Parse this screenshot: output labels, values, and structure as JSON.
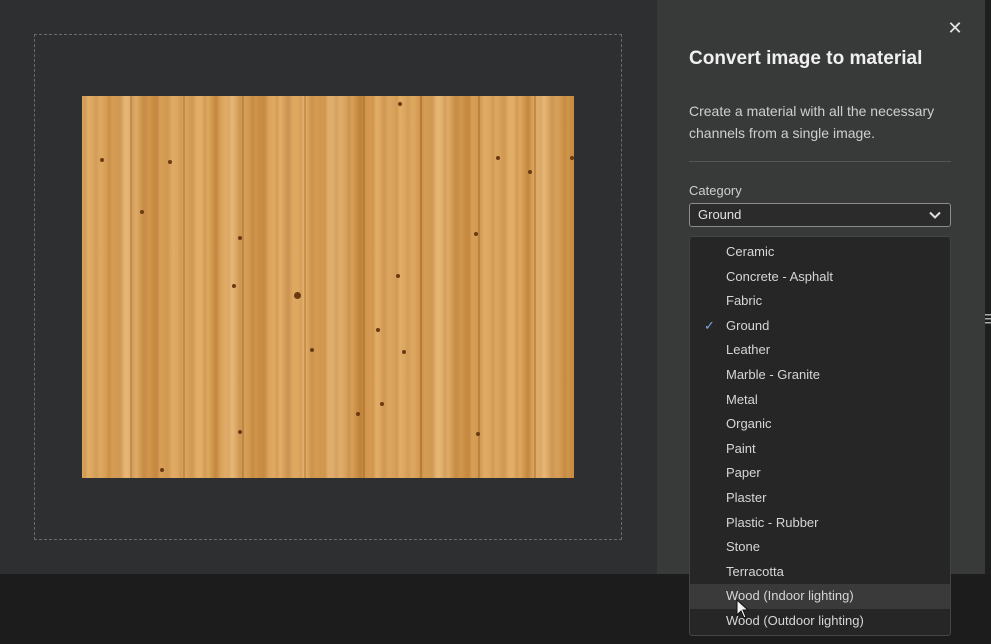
{
  "dialog": {
    "title": "Convert image to material",
    "description": "Create a material with all the necessary channels from a single image.",
    "close_icon": "close-icon"
  },
  "category": {
    "label": "Category",
    "selected": "Ground",
    "options": [
      "Ceramic",
      "Concrete - Asphalt",
      "Fabric",
      "Ground",
      "Leather",
      "Marble - Granite",
      "Metal",
      "Organic",
      "Paint",
      "Paper",
      "Plaster",
      "Plastic - Rubber",
      "Stone",
      "Terracotta",
      "Wood (Indoor lighting)",
      "Wood (Outdoor lighting)"
    ],
    "hovered": "Wood (Indoor lighting)"
  },
  "colors": {
    "panel_bg": "#383939",
    "stage_bg": "#2e2f30",
    "check_accent": "#7aa9e8"
  }
}
